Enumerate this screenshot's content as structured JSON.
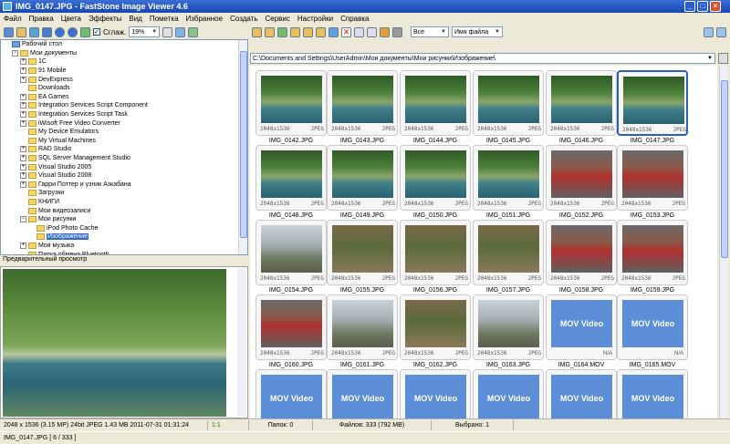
{
  "window": {
    "title": "IMG_0147.JPG  -  FastStone Image Viewer 4.6",
    "minimize": "_",
    "maximize": "□",
    "close": "×"
  },
  "menu": [
    "Файл",
    "Правка",
    "Цвета",
    "Эффекты",
    "Вид",
    "Пометка",
    "Избранное",
    "Создать",
    "Сервис",
    "Настройки",
    "Справка"
  ],
  "toolbar": {
    "smooth_label": "Сглаж.",
    "smooth_checked": "✓",
    "zoom_value": "19%"
  },
  "right_toolbar": {
    "filter_value": "Все",
    "sort_value": "Имя файла"
  },
  "tree": {
    "items": [
      {
        "label": "Рабочий стол",
        "level": 0,
        "toggle": ""
      },
      {
        "label": "Мои документы",
        "level": 1,
        "toggle": "−"
      },
      {
        "label": "1C",
        "level": 2,
        "toggle": "+"
      },
      {
        "label": "91 Mobile",
        "level": 2,
        "toggle": "+"
      },
      {
        "label": "DevExpress",
        "level": 2,
        "toggle": "+"
      },
      {
        "label": "Downloads",
        "level": 2,
        "toggle": ""
      },
      {
        "label": "EA Games",
        "level": 2,
        "toggle": "+"
      },
      {
        "label": "Integration Services Script Component",
        "level": 2,
        "toggle": "+"
      },
      {
        "label": "Integration Services Script Task",
        "level": 2,
        "toggle": "+"
      },
      {
        "label": "iWisoft Free Video Converter",
        "level": 2,
        "toggle": "+"
      },
      {
        "label": "My Device Emulators",
        "level": 2,
        "toggle": ""
      },
      {
        "label": "My Virtual Machines",
        "level": 2,
        "toggle": ""
      },
      {
        "label": "RAD Studio",
        "level": 2,
        "toggle": "+"
      },
      {
        "label": "SQL Server Management Studio",
        "level": 2,
        "toggle": "+"
      },
      {
        "label": "Visual Studio 2005",
        "level": 2,
        "toggle": "+"
      },
      {
        "label": "Visual Studio 2008",
        "level": 2,
        "toggle": "+"
      },
      {
        "label": "Гарри Поттер и узник Азкабана",
        "level": 2,
        "toggle": "+"
      },
      {
        "label": "Загрузки",
        "level": 2,
        "toggle": ""
      },
      {
        "label": "КНИГИ",
        "level": 2,
        "toggle": ""
      },
      {
        "label": "Мои видеозаписи",
        "level": 2,
        "toggle": ""
      },
      {
        "label": "Мои рисунки",
        "level": 2,
        "toggle": "−"
      },
      {
        "label": "iPod Photo Cache",
        "level": 3,
        "toggle": ""
      },
      {
        "label": "Изображение",
        "level": 3,
        "toggle": "",
        "selected": true
      },
      {
        "label": "Моя музыка",
        "level": 2,
        "toggle": "+"
      },
      {
        "label": "Папка обмена Bluetooth",
        "level": 2,
        "toggle": ""
      }
    ]
  },
  "preview": {
    "label": "Предварительный просмотр"
  },
  "address": {
    "path": "C:\\Documents and Settings\\UserAdmin\\Мои документы\\Мои рисунки\\Изображение\\"
  },
  "thumbnails": [
    {
      "name": "IMG_0142.JPG",
      "size": "2048x1536",
      "fmt": "JPEG",
      "kind": "photo",
      "v": ""
    },
    {
      "name": "IMG_0143.JPG",
      "size": "2048x1536",
      "fmt": "JPEG",
      "kind": "photo",
      "v": ""
    },
    {
      "name": "IMG_0144.JPG",
      "size": "2048x1536",
      "fmt": "JPEG",
      "kind": "photo",
      "v": ""
    },
    {
      "name": "IMG_0145.JPG",
      "size": "2048x1536",
      "fmt": "JPEG",
      "kind": "photo",
      "v": ""
    },
    {
      "name": "IMG_0146.JPG",
      "size": "2048x1536",
      "fmt": "JPEG",
      "kind": "photo",
      "v": ""
    },
    {
      "name": "IMG_0147.JPG",
      "size": "2048x1536",
      "fmt": "JPEG",
      "kind": "photo",
      "v": "",
      "active": true
    },
    {
      "name": "IMG_0148.JPG",
      "size": "2048x1536",
      "fmt": "JPEG",
      "kind": "photo",
      "v": ""
    },
    {
      "name": "IMG_0149.JPG",
      "size": "2048x1536",
      "fmt": "JPEG",
      "kind": "photo",
      "v": ""
    },
    {
      "name": "IMG_0150.JPG",
      "size": "2048x1536",
      "fmt": "JPEG",
      "kind": "photo",
      "v": ""
    },
    {
      "name": "IMG_0151.JPG",
      "size": "2048x1536",
      "fmt": "JPEG",
      "kind": "photo",
      "v": ""
    },
    {
      "name": "IMG_0152.JPG",
      "size": "2048x1536",
      "fmt": "JPEG",
      "kind": "photo",
      "v": "v2"
    },
    {
      "name": "IMG_0153.JPG",
      "size": "2048x1536",
      "fmt": "JPEG",
      "kind": "photo",
      "v": "v2"
    },
    {
      "name": "IMG_0154.JPG",
      "size": "2048x1536",
      "fmt": "JPEG",
      "kind": "photo",
      "v": "v3"
    },
    {
      "name": "IMG_0155.JPG",
      "size": "2048x1536",
      "fmt": "JPEG",
      "kind": "photo",
      "v": "v4"
    },
    {
      "name": "IMG_0156.JPG",
      "size": "2048x1536",
      "fmt": "JPEG",
      "kind": "photo",
      "v": "v4"
    },
    {
      "name": "IMG_0157.JPG",
      "size": "2048x1536",
      "fmt": "JPEG",
      "kind": "photo",
      "v": "v4"
    },
    {
      "name": "IMG_0158.JPG",
      "size": "2048x1536",
      "fmt": "JPEG",
      "kind": "photo",
      "v": "v2"
    },
    {
      "name": "IMG_0159.JPG",
      "size": "2048x1536",
      "fmt": "JPEG",
      "kind": "photo",
      "v": "v2"
    },
    {
      "name": "IMG_0160.JPG",
      "size": "2048x1536",
      "fmt": "JPEG",
      "kind": "photo",
      "v": "v2"
    },
    {
      "name": "IMG_0161.JPG",
      "size": "2048x1536",
      "fmt": "JPEG",
      "kind": "photo",
      "v": "v3"
    },
    {
      "name": "IMG_0162.JPG",
      "size": "2048x1536",
      "fmt": "JPEG",
      "kind": "photo",
      "v": "v4"
    },
    {
      "name": "IMG_0163.JPG",
      "size": "2048x1536",
      "fmt": "JPEG",
      "kind": "photo",
      "v": "v3"
    },
    {
      "name": "IMG_0164.MOV",
      "size": "",
      "fmt": "N/A",
      "kind": "video",
      "video_label": "MOV Video"
    },
    {
      "name": "IMG_0165.MOV",
      "size": "",
      "fmt": "N/A",
      "kind": "video",
      "video_label": "MOV Video"
    },
    {
      "name": "",
      "size": "",
      "fmt": "",
      "kind": "video",
      "video_label": "MOV Video"
    },
    {
      "name": "",
      "size": "",
      "fmt": "",
      "kind": "video",
      "video_label": "MOV Video"
    },
    {
      "name": "",
      "size": "",
      "fmt": "",
      "kind": "video",
      "video_label": "MOV Video"
    },
    {
      "name": "",
      "size": "",
      "fmt": "",
      "kind": "video",
      "video_label": "MOV Video"
    },
    {
      "name": "",
      "size": "",
      "fmt": "",
      "kind": "video",
      "video_label": "MOV Video"
    },
    {
      "name": "",
      "size": "",
      "fmt": "",
      "kind": "video",
      "video_label": "MOV Video"
    }
  ],
  "status": {
    "image_info": "2048 x 1536 (3.15 MP)  24bit  JPEG   1.43 MB   2011-07-31 01:31:24",
    "ratio": "1:1",
    "folders": "Папок: 0",
    "files": "Файлов: 333 (792 MB)",
    "selected": "Выбрано: 1",
    "current_file": "IMG_0147.JPG [ 6 / 333 ]"
  }
}
